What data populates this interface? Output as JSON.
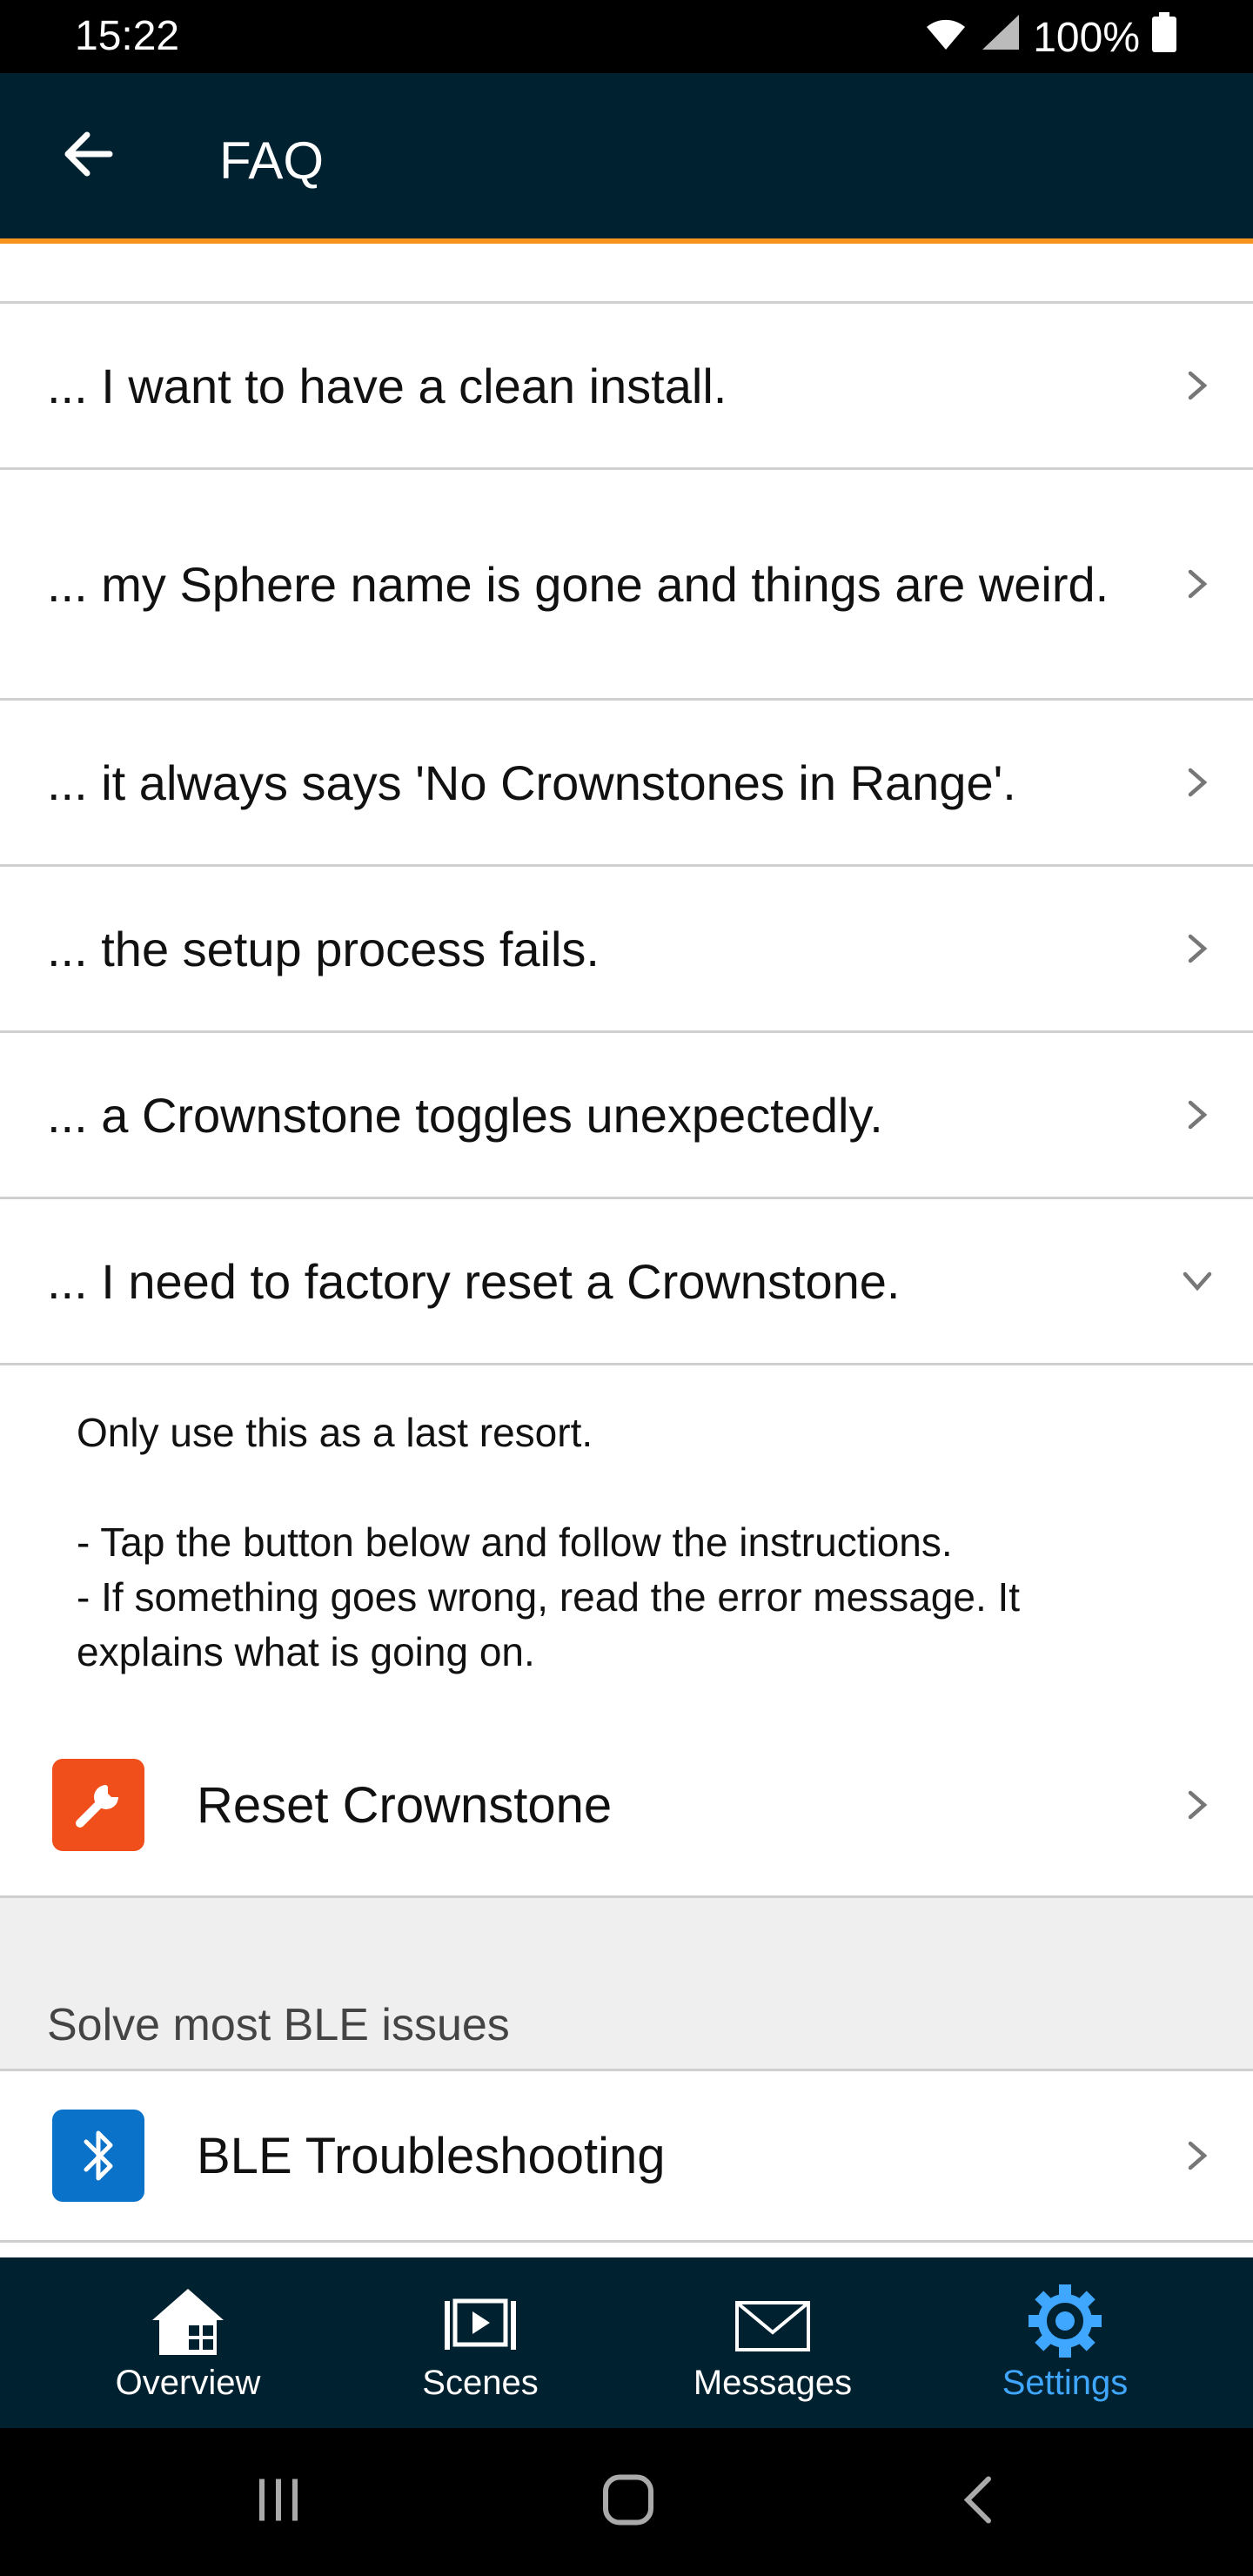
{
  "status": {
    "time": "15:22",
    "battery": "100%"
  },
  "header": {
    "title": "FAQ"
  },
  "faq": [
    {
      "label": "... I want to have a clean install."
    },
    {
      "label": "... my Sphere name is gone and things are weird."
    },
    {
      "label": "... it always says 'No Crownstones in Range'."
    },
    {
      "label": "... the setup process fails."
    },
    {
      "label": "... a Crownstone toggles unexpectedly."
    },
    {
      "label": "... I need to factory reset a Crownstone."
    }
  ],
  "answer": {
    "line1": "Only use this as a last resort.",
    "line2": "- Tap the button below and follow the instructions.",
    "line3": "- If something goes wrong, read the error message. It explains what is going on."
  },
  "reset": {
    "label": "Reset Crownstone",
    "color": "#f04e1b"
  },
  "ble_section": {
    "title": "Solve most BLE issues"
  },
  "ble": {
    "label": "BLE Troubleshooting",
    "color": "#0a72c9"
  },
  "tabs": [
    {
      "label": "Overview",
      "icon": "house-icon"
    },
    {
      "label": "Scenes",
      "icon": "scenes-icon"
    },
    {
      "label": "Messages",
      "icon": "envelope-icon"
    },
    {
      "label": "Settings",
      "icon": "gear-icon",
      "active": true
    }
  ],
  "colors": {
    "appbar": "#00212f",
    "accent": "#f7941d",
    "active_tab": "#3fa7ff"
  }
}
